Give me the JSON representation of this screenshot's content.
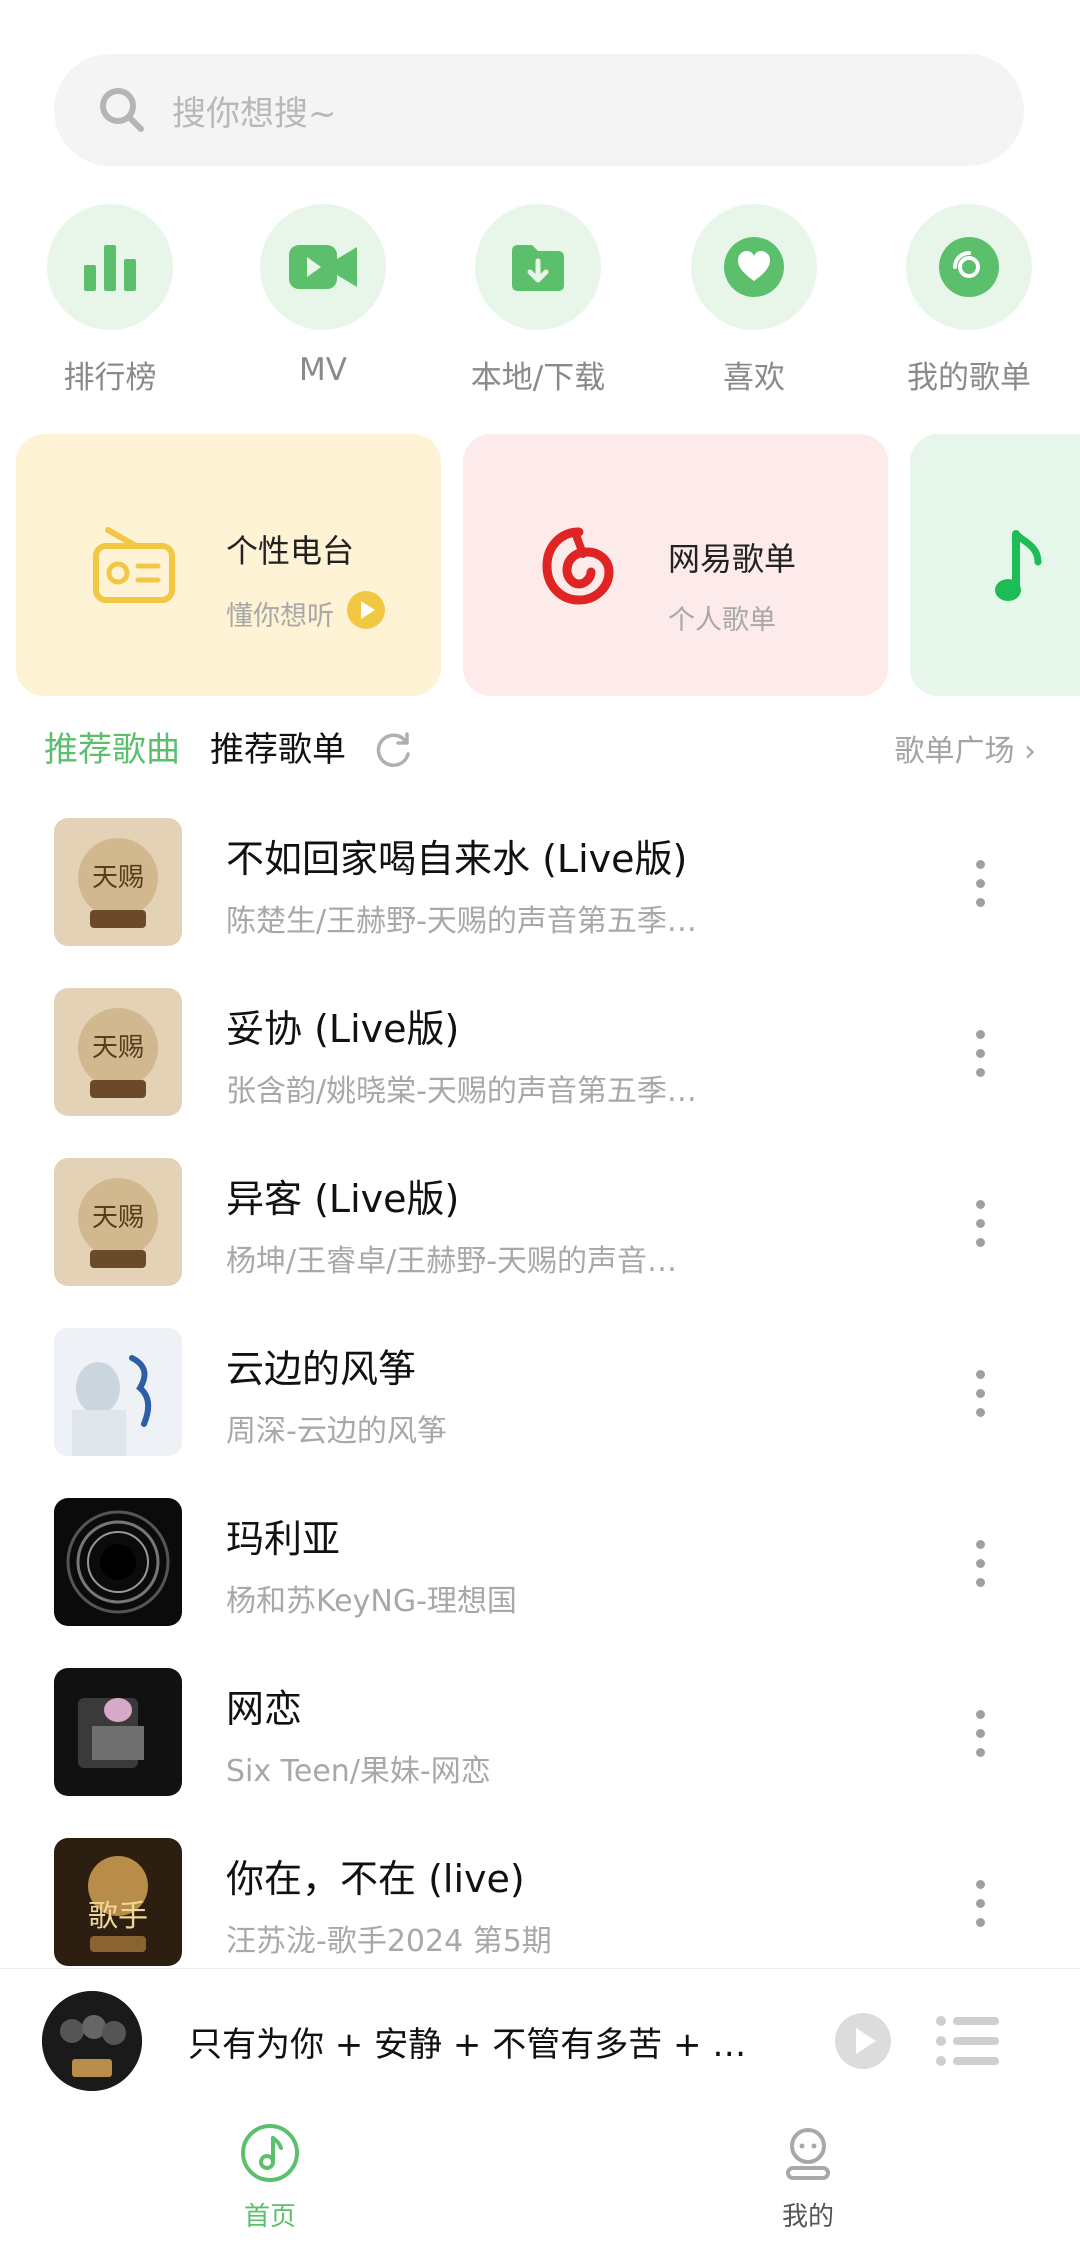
{
  "search": {
    "placeholder": "搜你想搜~"
  },
  "quick_actions": [
    {
      "label": "排行榜",
      "icon": "chart-bars-icon"
    },
    {
      "label": "MV",
      "icon": "video-camera-icon"
    },
    {
      "label": "本地/下载",
      "icon": "download-folder-icon"
    },
    {
      "label": "喜欢",
      "icon": "heart-icon"
    },
    {
      "label": "我的歌单",
      "icon": "disc-icon"
    }
  ],
  "cards": [
    {
      "title": "个性电台",
      "subtitle": "懂你想听",
      "icon": "radio-icon"
    },
    {
      "title": "网易歌单",
      "subtitle": "个人歌单",
      "icon": "netease-logo-icon"
    },
    {
      "icon": "music-note-icon"
    }
  ],
  "tabs": {
    "active": "推荐歌曲",
    "inactive": "推荐歌单",
    "plaza": "歌单广场 ›"
  },
  "songs": [
    {
      "title": "不如回家喝自来水 (Live版)",
      "subtitle": "陈楚生/王赫野-天赐的声音第五季…"
    },
    {
      "title": "妥协 (Live版)",
      "subtitle": "张含韵/姚晓棠-天赐的声音第五季…"
    },
    {
      "title": "异客 (Live版)",
      "subtitle": "杨坤/王睿卓/王赫野-天赐的声音…"
    },
    {
      "title": "云边的风筝",
      "subtitle": "周深-云边的风筝"
    },
    {
      "title": "玛利亚",
      "subtitle": "杨和苏KeyNG-理想国"
    },
    {
      "title": "网恋",
      "subtitle": "Six Teen/果妹-网恋"
    },
    {
      "title": "你在，不在 (live)",
      "subtitle": "汪苏泷-歌手2024 第5期"
    }
  ],
  "player": {
    "title": "只有为你 + 安静 + 不管有多苦 + …"
  },
  "nav": [
    {
      "label": "首页",
      "active": true
    },
    {
      "label": "我的",
      "active": false
    }
  ],
  "colors": {
    "accent": "#5cbf6c",
    "netease_red": "#e02424",
    "icon_yellow": "#f2c744"
  }
}
